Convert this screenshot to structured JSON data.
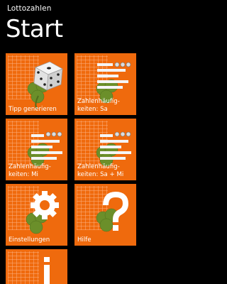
{
  "header": {
    "app_title": "Lottozahlen",
    "page_title": "Start"
  },
  "tiles": [
    {
      "label": "Tipp generieren",
      "icon": "dice-icon"
    },
    {
      "label": "Zahlenhäufig-keiten: Sa",
      "icon": "statistics-icon"
    },
    {
      "label": "Zahlenhäufig-keiten: Mi",
      "icon": "statistics-icon"
    },
    {
      "label": "Zahlenhäufig-keiten: Sa + Mi",
      "icon": "statistics-icon"
    },
    {
      "label": "Einstellungen",
      "icon": "gear-icon"
    },
    {
      "label": "Hilfe",
      "icon": "question-mark-icon"
    },
    {
      "label": "",
      "icon": "info-icon"
    }
  ],
  "colors": {
    "tile": "#ef6a0d",
    "background": "#000000",
    "clover": "#6b8f2a"
  }
}
